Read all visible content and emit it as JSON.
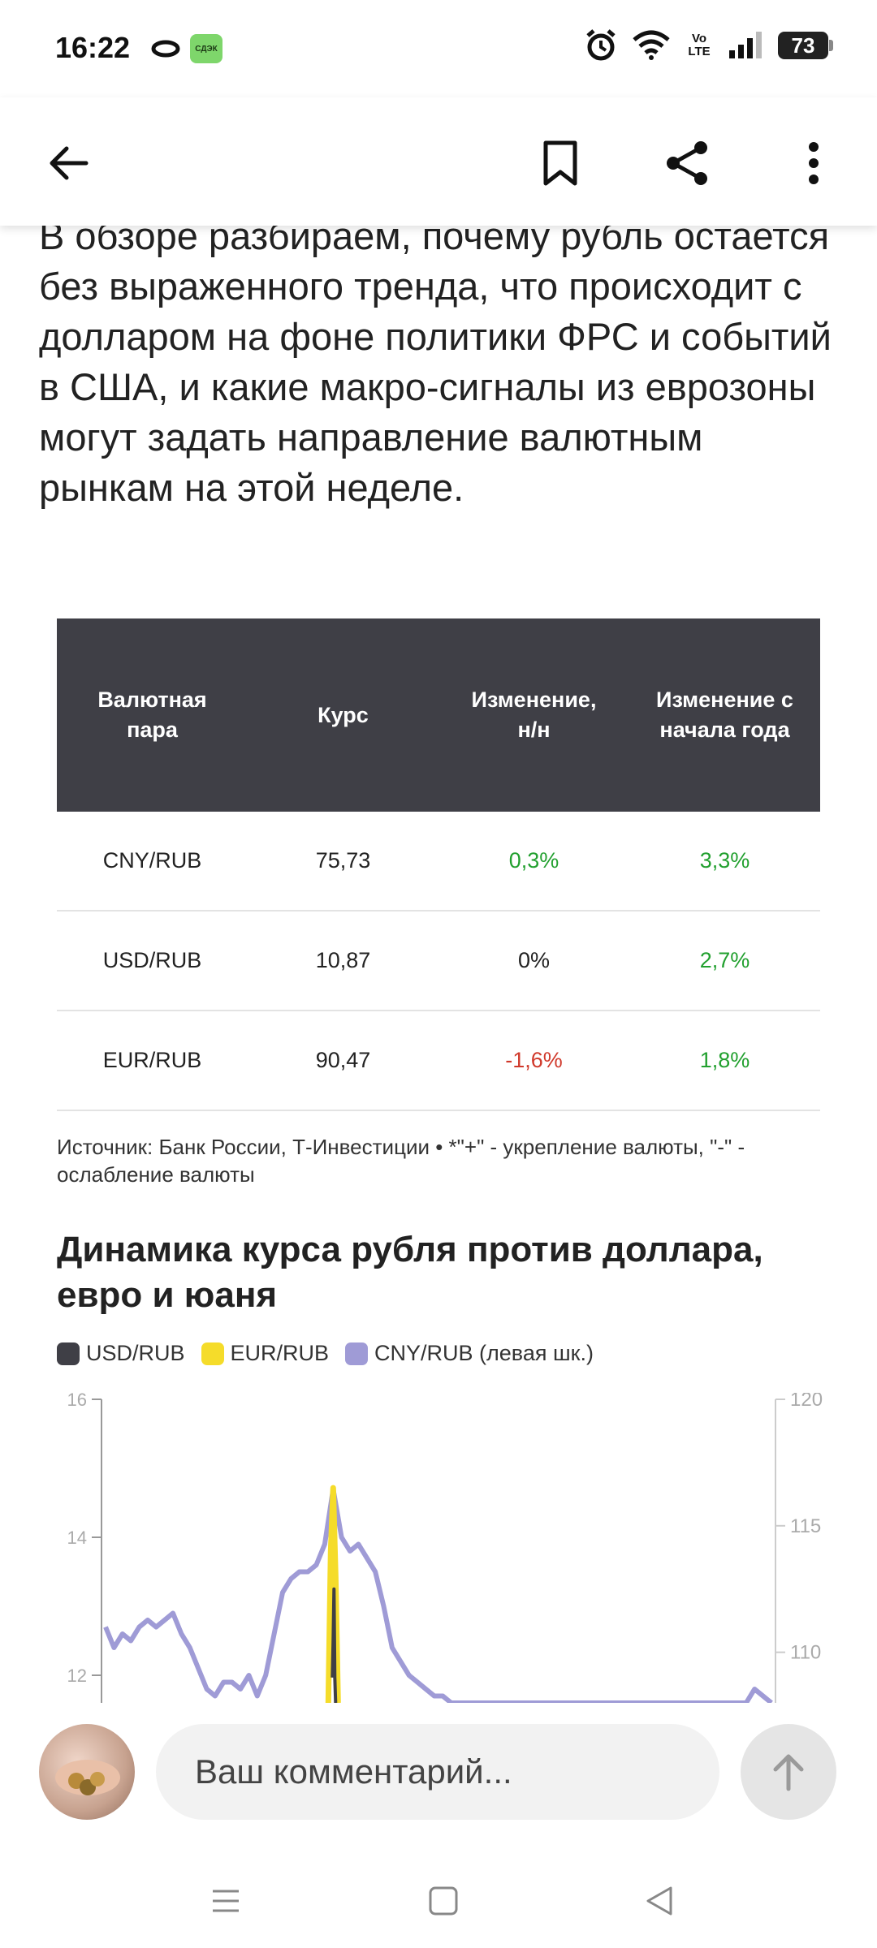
{
  "status_bar": {
    "time": "16:22",
    "app_badge": "СДЭК",
    "network": "Vo LTE",
    "battery": "73",
    "icons": [
      "circle-notification-icon",
      "cdek-app-icon",
      "alarm-icon",
      "wifi-icon",
      "volte-icon",
      "signal-icon",
      "battery-icon"
    ]
  },
  "app_bar": {
    "icons": [
      "back-arrow-icon",
      "bookmark-icon",
      "share-icon",
      "more-vert-icon"
    ]
  },
  "article": {
    "intro": "В обзоре разбираем, почему рубль остается без выраженного тренда, что происходит с долларом на фоне политики ФРС и событий в США, и какие макро-сигналы из еврозоны могут задать направление валютным рынкам на этой неделе."
  },
  "table": {
    "headers": [
      "Валютная пара",
      "Курс",
      "Изменение, н/н",
      "Изменение с начала года"
    ],
    "rows": [
      {
        "pair": "CNY/RUB",
        "rate": "75,73",
        "week": "0,3%",
        "ytd": "3,3%"
      },
      {
        "pair": "USD/RUB",
        "rate": "10,87",
        "week": "0%",
        "ytd": "2,7%"
      },
      {
        "pair": "EUR/RUB",
        "rate": "90,47",
        "week": "-1,6%",
        "ytd": "1,8%"
      }
    ],
    "source": "Источник: Банк России, Т-Инвестиции • *\"+\" - укрепление валюты, \"-\" - ослабление валюты"
  },
  "chart_section": {
    "title": "Динамика курса рубля против доллара, евро и юаня"
  },
  "chart_data": {
    "type": "line",
    "title": "Динамика курса рубля против доллара, евро и юаня",
    "legend_position": "top-left",
    "left_axis": {
      "ticks": [
        "16",
        "14",
        "12"
      ],
      "range_visible": [
        11.6,
        16
      ]
    },
    "right_axis": {
      "ticks": [
        "120",
        "115",
        "110"
      ],
      "range_visible": [
        108,
        120
      ]
    },
    "series": [
      {
        "name": "USD/RUB",
        "color": "#3f3f46",
        "axis": "right",
        "values": [
          109,
          110.5,
          112.5,
          109,
          108
        ]
      },
      {
        "name": "EUR/RUB",
        "color": "#f5dc2a",
        "axis": "right",
        "values": [
          108,
          114,
          116.5,
          113,
          108
        ]
      },
      {
        "name": "CNY/RUB (левая шк.)",
        "color": "#9f9bd6",
        "axis": "left",
        "values": [
          12.7,
          12.4,
          12.6,
          12.5,
          12.7,
          12.8,
          12.7,
          12.8,
          12.9,
          12.6,
          12.4,
          12.1,
          11.8,
          11.7,
          11.9,
          11.9,
          11.8,
          12.0,
          11.7,
          12.0,
          12.6,
          13.2,
          13.4,
          13.5,
          13.5,
          13.6,
          13.9,
          14.7,
          14.0,
          13.8,
          13.9,
          13.7,
          13.5,
          13.0,
          12.4,
          12.2,
          12.0,
          11.9,
          11.8,
          11.7,
          11.7,
          11.6,
          11.6,
          11.6,
          11.6,
          11.6,
          11.6,
          11.6,
          11.6,
          11.6,
          11.6,
          11.6,
          11.6,
          11.6,
          11.6,
          11.6,
          11.6,
          11.6,
          11.6,
          11.6,
          11.6,
          11.6,
          11.6,
          11.6,
          11.6,
          11.6,
          11.6,
          11.6,
          11.6,
          11.6,
          11.6,
          11.6,
          11.6,
          11.6,
          11.6,
          11.6,
          11.6,
          11.8,
          11.7,
          11.6
        ]
      }
    ]
  },
  "comment_bar": {
    "placeholder": "Ваш комментарий..."
  }
}
